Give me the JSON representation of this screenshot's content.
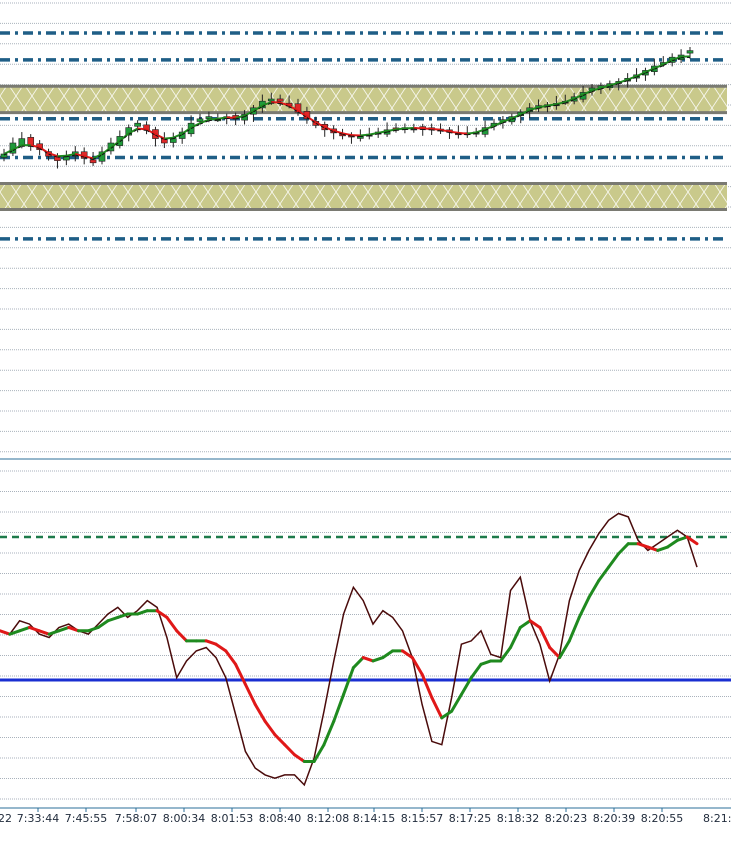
{
  "colors": {
    "grid": "#a9b2bc",
    "level_dash": "#1f5e86",
    "zone_fill": "#c9c98b",
    "zone_border": "#7a7a72",
    "candle_up": "#1f9a3a",
    "candle_down": "#e02828",
    "ma_green": "#1f8a1f",
    "ma_red": "#e01818",
    "osc_fast": "#4a0b0b",
    "osc_mid_line": "#1a2fd1",
    "osc_upper_line": "#1d7a4a",
    "axis_text": "#1f2a3a"
  },
  "chart_data": [
    {
      "type": "candlestick",
      "title": "",
      "xlabel": "",
      "ylabel": "",
      "ylim": [
        0,
        100
      ],
      "grid": true,
      "legend": "none",
      "y_scale_note": "no price axis printed; values normalized 0-100",
      "levels": [
        {
          "value": 92.5,
          "style": "dash-dot"
        },
        {
          "value": 86.4,
          "style": "dash-dot"
        },
        {
          "value": 73.0,
          "style": "dash-dot"
        },
        {
          "value": 64.2,
          "style": "dash-dot"
        },
        {
          "value": 45.7,
          "style": "dash-dot"
        }
      ],
      "zones": [
        {
          "from": 74.4,
          "to": 80.4
        },
        {
          "from": 52.4,
          "to": 58.3
        }
      ],
      "closes": [
        65.0,
        67.5,
        68.5,
        67.0,
        66.0,
        64.5,
        63.5,
        64.5,
        65.5,
        64.0,
        63.0,
        65.5,
        67.5,
        69.0,
        71.0,
        72.0,
        70.5,
        68.5,
        67.5,
        68.5,
        70.0,
        72.0,
        73.0,
        73.5,
        73.0,
        73.5,
        73.0,
        74.0,
        75.5,
        77.0,
        77.5,
        77.0,
        76.0,
        74.5,
        73.0,
        71.5,
        70.5,
        69.8,
        69.3,
        69.0,
        69.0,
        69.5,
        70.0,
        70.5,
        70.8,
        71.0,
        71.0,
        70.8,
        70.8,
        70.5,
        70.0,
        69.5,
        69.5,
        70.0,
        71.0,
        72.0,
        72.8,
        73.5,
        74.5,
        75.5,
        76.0,
        76.2,
        76.5,
        77.0,
        78.0,
        79.0,
        80.0,
        80.5,
        81.0,
        81.5,
        82.2,
        83.0,
        84.0,
        85.0,
        85.8,
        87.0,
        87.5,
        88.5
      ],
      "ma_series": [
        {
          "values": [
            65.0,
            66.0,
            67.0,
            67.0,
            66.5,
            65.2,
            64.5,
            64.6,
            65.0,
            64.5,
            64.0,
            65.0,
            66.5,
            68.0,
            69.7,
            70.8,
            70.6,
            69.5,
            68.5,
            68.7,
            69.6,
            71.0,
            72.0,
            72.8,
            73.0,
            73.3,
            73.2,
            73.7,
            74.8,
            76.0,
            76.8,
            76.7,
            76.0,
            74.8,
            73.5,
            72.2,
            71.1,
            70.3,
            69.7,
            69.3,
            69.2,
            69.4,
            69.8,
            70.2,
            70.6,
            70.8,
            70.9,
            70.8,
            70.7,
            70.5,
            70.1,
            69.8,
            69.6,
            69.9,
            70.6,
            71.4,
            72.3,
            73.1,
            74.0,
            75.0,
            75.6,
            76.0,
            76.3,
            76.8,
            77.6,
            78.5,
            79.4,
            80.0,
            80.6,
            81.2,
            81.9,
            82.7,
            83.6,
            84.5,
            85.3,
            86.4,
            87.1,
            87.2
          ]
        }
      ]
    },
    {
      "type": "line",
      "title": "",
      "xlabel": "",
      "ylabel": "",
      "ylim": [
        0,
        100
      ],
      "grid": true,
      "legend": "none",
      "x": [
        "7:33:44",
        "7:45:55",
        "7:58:07",
        "8:00:34",
        "8:01:53",
        "8:08:40",
        "8:12:08",
        "8:14:15",
        "8:15:57",
        "8:17:25",
        "8:18:32",
        "8:20:23",
        "8:20:39",
        "8:20:55"
      ],
      "levels": [
        {
          "value": 80.0,
          "style": "dashed"
        },
        {
          "value": 37.3,
          "style": "solid"
        }
      ],
      "series": [
        {
          "values": [
            52,
            51,
            55,
            54,
            51,
            50,
            53,
            54,
            52,
            51,
            54,
            57,
            59,
            56,
            58,
            61,
            59,
            50,
            38,
            43,
            46,
            47,
            44,
            38,
            27,
            16,
            11,
            9,
            8,
            9,
            9,
            6,
            14,
            28,
            43,
            57,
            65,
            61,
            54,
            58,
            56,
            52,
            44,
            30,
            19,
            18,
            32,
            48,
            49,
            52,
            45,
            44,
            64,
            68,
            55,
            48,
            37,
            45,
            61,
            70,
            76,
            81,
            85,
            87,
            86,
            79,
            76,
            78,
            80,
            82,
            80,
            71
          ]
        },
        {
          "values": [
            52,
            51,
            52,
            53,
            52,
            51,
            52,
            53,
            52,
            52,
            53,
            55,
            56,
            57,
            57,
            58,
            58,
            56,
            52,
            49,
            49,
            49,
            48,
            46,
            42,
            36,
            30,
            25,
            21,
            18,
            15,
            13,
            13,
            18,
            25,
            33,
            41,
            44,
            43,
            44,
            46,
            46,
            44,
            39,
            32,
            26,
            28,
            33,
            38,
            42,
            43,
            43,
            47,
            53,
            55,
            53,
            47,
            44,
            49,
            56,
            62,
            67,
            71,
            75,
            78,
            78,
            77,
            76,
            77,
            79,
            80,
            78
          ]
        }
      ]
    }
  ]
}
